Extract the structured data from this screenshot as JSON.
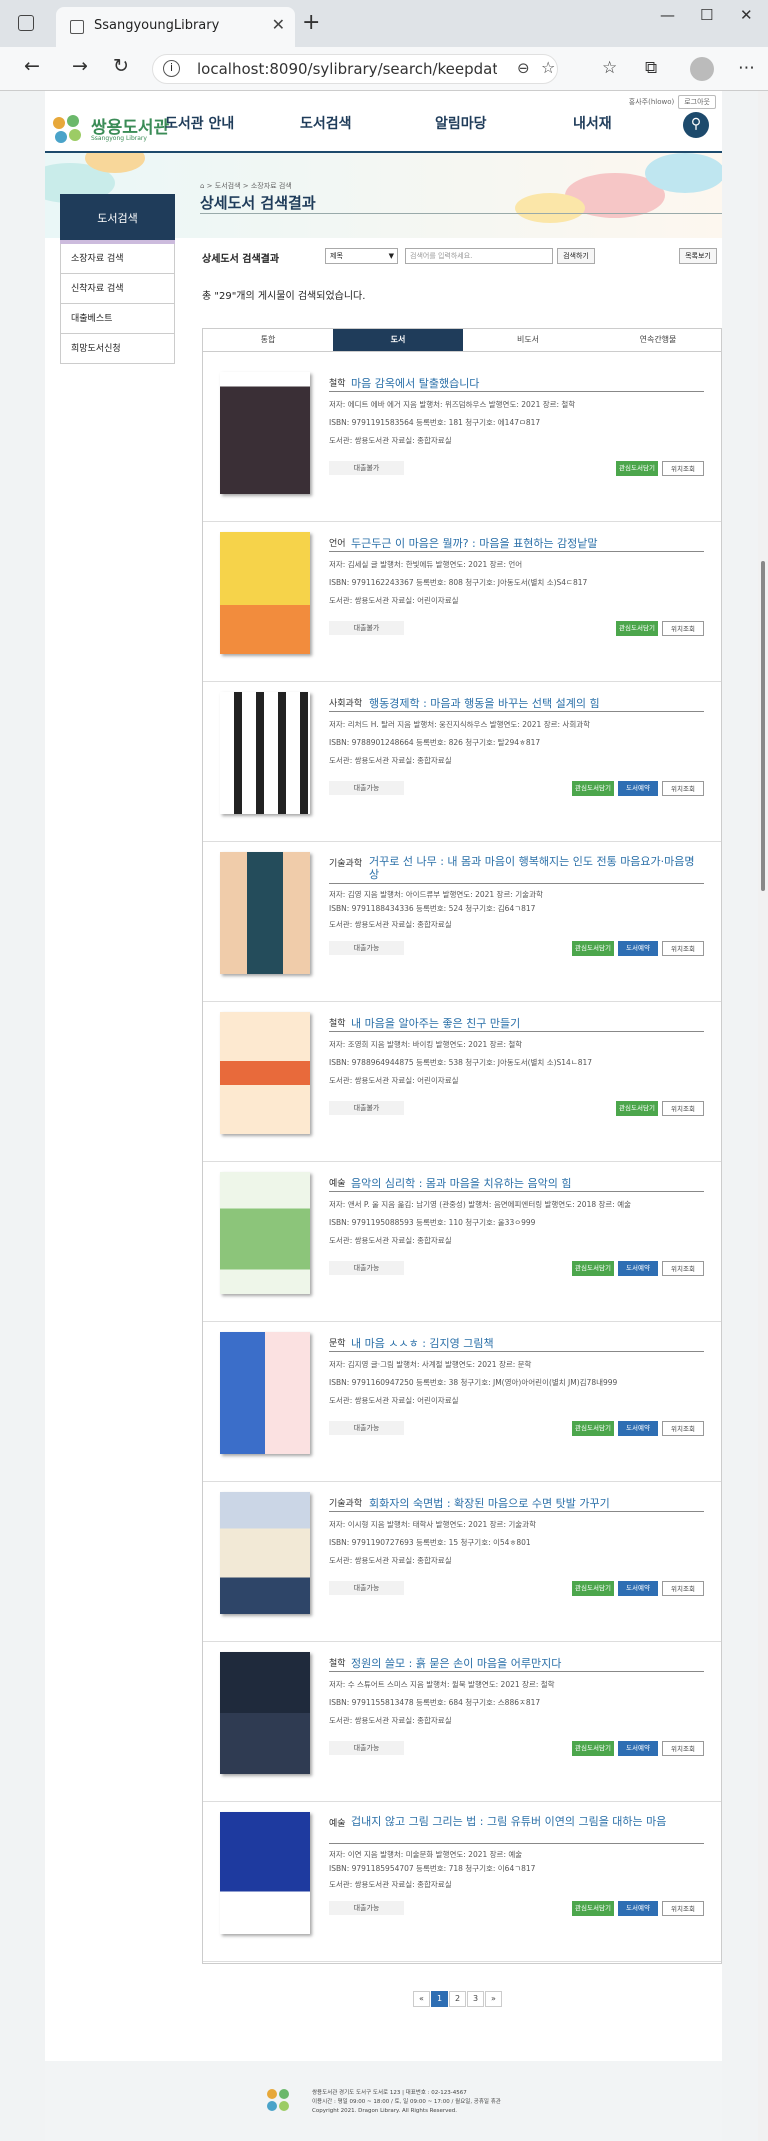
{
  "browser": {
    "tab_title": "SsangyoungLibrary",
    "url": "localhost:8090/sylibrary/search/keepdata/keepd..."
  },
  "header": {
    "top_user": "홍사주(hlowo)",
    "login": "로그아웃",
    "logo_name": "쌍용도서관",
    "logo_sub": "Ssangyong Library",
    "nav": [
      "도서관 안내",
      "도서검색",
      "알림마당",
      "내서재"
    ]
  },
  "banner": {
    "breadcrumb": "⌂ > 도서검색 > 소장자료 검색",
    "title": "상세도서 검색결과"
  },
  "sidebar": {
    "heading": "도서검색",
    "items": [
      "소장자료 검색",
      "신착자료 검색",
      "대출베스트",
      "희망도서신청"
    ]
  },
  "search": {
    "label": "상세도서 검색결과",
    "select": "제목",
    "placeholder": "검색어를 입력하세요.",
    "button": "검색하기",
    "list_button": "목록보기"
  },
  "result_count": "총 \"29\"개의 게시물이 검색되었습니다.",
  "tabs": [
    "통합",
    "도서",
    "비도서",
    "연속간행물"
  ],
  "active_tab": 1,
  "books": [
    {
      "cat": "철학",
      "title": "마음 감옥에서 탈출했습니다",
      "m1": "저자: 에디트 에바 에거 지음   발행처: 위즈덤하우스   발행연도: 2021   장르: 철학",
      "m2": "ISBN: 9791191583564   등록번호: 181   청구기호: 에147ㅁ817",
      "m3": "도서관: 쌍용도서관   자료실: 종합자료실",
      "status": "대출불가",
      "buttons": [
        "관심도서담기",
        "위치조회"
      ]
    },
    {
      "cat": "언어",
      "title": "두근두근 이 마음은 뭘까? : 마음을 표현하는 감정낱말",
      "m1": "저자: 김세실 글   발행처: 한빛에듀   발행연도: 2021   장르: 언어",
      "m2": "ISBN: 9791162243367   등록번호: 808   청구기호: J아동도서(별치 소)S4ㄷ817",
      "m3": "도서관: 쌍용도서관   자료실: 어린이자료실",
      "status": "대출불가",
      "buttons": [
        "관심도서담기",
        "위치조회"
      ]
    },
    {
      "cat": "사회과학",
      "title": "행동경제학 : 마음과 행동을 바꾸는 선택 설계의 힘",
      "m1": "저자: 리처드 H. 탈러 지음   발행처: 웅진지식하우스   발행연도: 2021   장르: 사회과학",
      "m2": "ISBN: 9788901248664   등록번호: 826   청구기호: 탈294ㅎ817",
      "m3": "도서관: 쌍용도서관   자료실: 종합자료실",
      "status": "대출가능",
      "buttons": [
        "관심도서담기",
        "도서예약",
        "위치조회"
      ]
    },
    {
      "cat": "기술과학",
      "title": "거꾸로 선 나무 : 내 몸과 마음이 행복해지는 인도 전통 마음요가·마음명상",
      "m1": "저자: 김영 지음   발행처: 아이드류부   발행연도: 2021   장르: 기술과학",
      "m2": "ISBN: 9791188434336   등록번호: 524   청구기호: 김64ㄱ817",
      "m3": "도서관: 쌍용도서관   자료실: 종합자료실",
      "status": "대출가능",
      "buttons": [
        "관심도서담기",
        "도서예약",
        "위치조회"
      ]
    },
    {
      "cat": "철학",
      "title": "내 마음을 알아주는 좋은 친구 만들기",
      "m1": "저자: 조영희 지음   발행처: 바이킹   발행연도: 2021   장르: 철학",
      "m2": "ISBN: 9788964944875   등록번호: 538   청구기호: J아동도서(별치 소)S14ㄴ817",
      "m3": "도서관: 쌍용도서관   자료실: 어린이자료실",
      "status": "대출불가",
      "buttons": [
        "관심도서담기",
        "위치조회"
      ]
    },
    {
      "cat": "예술",
      "title": "음악의 심리학 : 몸과 마음을 치유하는 음악의 힘",
      "m1": "저자: 앤서 P. 울 지음 옮김: 남기영 (관중성)   발행처: 음면에피엔터링   발행연도: 2018   장르: 예술",
      "m2": "ISBN: 9791195088593   등록번호: 110   청구기호: 울33ㅇ999",
      "m3": "도서관: 쌍용도서관   자료실: 종합자료실",
      "status": "대출가능",
      "buttons": [
        "관심도서담기",
        "도서예약",
        "위치조회"
      ]
    },
    {
      "cat": "문학",
      "title": "내 마음 ㅅㅅㅎ : 김지영 그림책",
      "m1": "저자: 김지영 글·그림   발행처: 사계절   발행연도: 2021   장르: 문학",
      "m2": "ISBN: 9791160947250   등록번호: 38   청구기호: JM(영아)아어린이(별치 JM)김78내999",
      "m3": "도서관: 쌍용도서관   자료실: 어린이자료실",
      "status": "대출가능",
      "buttons": [
        "관심도서담기",
        "도서예약",
        "위치조회"
      ]
    },
    {
      "cat": "기술과학",
      "title": "회화자의 숙면법 : 확장된 마음으로 수면 탓발 가꾸기",
      "m1": "저자: 이시형 지음   발행처: 태학사   발행연도: 2021   장르: 기술과학",
      "m2": "ISBN: 9791190727693   등록번호: 15   청구기호: 이54ㅎ801",
      "m3": "도서관: 쌍용도서관   자료실: 종합자료실",
      "status": "대출가능",
      "buttons": [
        "관심도서담기",
        "도서예약",
        "위치조회"
      ]
    },
    {
      "cat": "철학",
      "title": "정원의 쓸모 : 흙 묻은 손이 마음을 어루만지다",
      "m1": "저자: 수 스튜어트 스미스 지음   발행처: 윌북   발행연도: 2021   장르: 철학",
      "m2": "ISBN: 9791155813478   등록번호: 684   청구기호: 스886ㅈ817",
      "m3": "도서관: 쌍용도서관   자료실: 종합자료실",
      "status": "대출가능",
      "buttons": [
        "관심도서담기",
        "도서예약",
        "위치조회"
      ]
    },
    {
      "cat": "예술",
      "title": "겁내지 않고 그림 그리는 법 : 그림 유튜버 이연의 그림을 대하는 마음",
      "m1": "저자: 이연 지음   발행처: 미술문화   발행연도: 2021   장르: 예술",
      "m2": "ISBN: 9791185954707   등록번호: 718   청구기호: 이64ㄱ817",
      "m3": "도서관: 쌍용도서관   자료실: 종합자료실",
      "status": "대출가능",
      "buttons": [
        "관심도서담기",
        "도서예약",
        "위치조회"
      ]
    }
  ],
  "pager": [
    "«",
    "1",
    "2",
    "3",
    "»"
  ],
  "footer": {
    "l1": "쌍용도서관 경기도 도서구 도서로 123 | 대표번호 : 02-123-4567",
    "l2": "이용시간 : 평일 09:00 ~ 18:00 / 토, 일 09:00 ~ 17:00 / 월요일, 공휴일 휴관",
    "l3": "Copyright 2021. Dragon Library. All Rights Reserved."
  }
}
